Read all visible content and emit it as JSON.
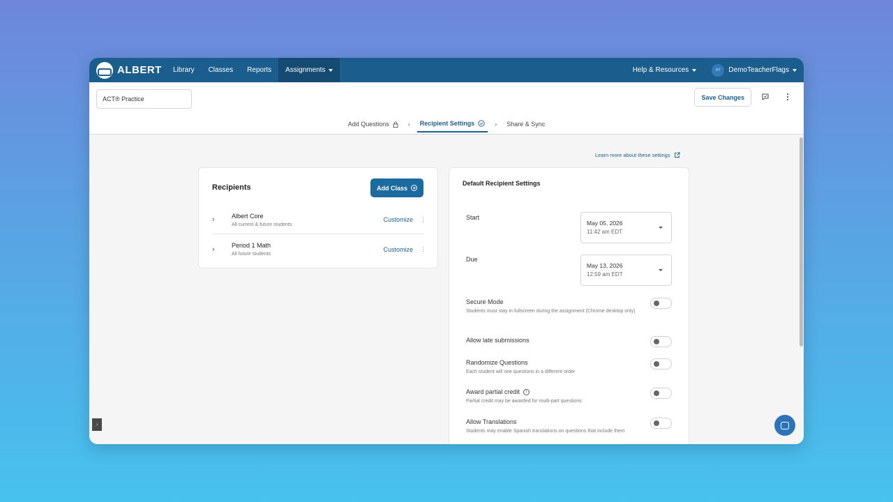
{
  "nav": {
    "brand": "ALBERT",
    "items": [
      "Library",
      "Classes",
      "Reports",
      "Assignments"
    ],
    "help": "Help & Resources",
    "avatar_initials": "RT",
    "user": "DemoTeacherFlags"
  },
  "header": {
    "title_value": "ACT® Practice",
    "save_label": "Save Changes",
    "steps": [
      "Add Questions",
      "Recipient Settings",
      "Share & Sync"
    ]
  },
  "main": {
    "learn_more": "Learn more about these settings",
    "recipients": {
      "title": "Recipients",
      "add_class": "Add Class",
      "classes": [
        {
          "name": "Albert Core",
          "sub": "All current & future students",
          "action": "Customize"
        },
        {
          "name": "Period 1 Math",
          "sub": "All future students",
          "action": "Customize"
        }
      ]
    },
    "defaults": {
      "title": "Default Recipient Settings",
      "start_label": "Start",
      "start_date": "May 05, 2026",
      "start_time": "11:42 am EDT",
      "due_label": "Due",
      "due_date": "May 13, 2026",
      "due_time": "12:59 am EDT",
      "toggles": [
        {
          "label": "Secure Mode",
          "desc": "Students must stay in fullscreen during the assignment (Chrome desktop only)"
        },
        {
          "label": "Allow late submissions",
          "desc": ""
        },
        {
          "label": "Randomize Questions",
          "desc": "Each student will see questions in a different order"
        },
        {
          "label": "Award partial credit",
          "desc": "Partial credit may be awarded for multi-part questions"
        },
        {
          "label": "Allow Translations",
          "desc": "Students may enable Spanish translations on questions that include them"
        }
      ]
    }
  },
  "colors": {
    "brand": "#1b5e8e",
    "accent": "#1b6aa0"
  }
}
